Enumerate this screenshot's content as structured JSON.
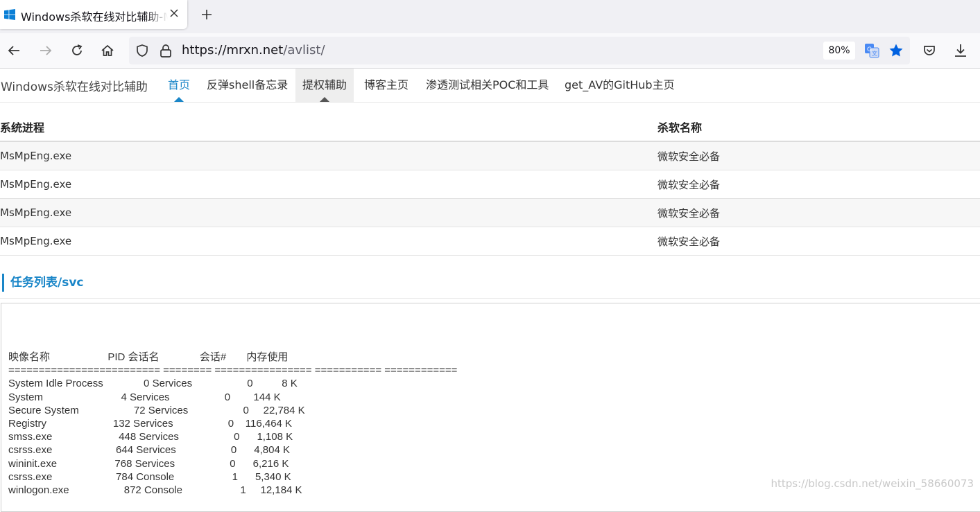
{
  "browser": {
    "tab_title": "Windows杀软在线对比辅助-Mrxn",
    "url_host": "https://mrxn.net",
    "url_path": "/avlist/",
    "zoom": "80%"
  },
  "site": {
    "brand": "Windows杀软在线对比辅助",
    "nav": [
      "首页",
      "反弹shell备忘录",
      "提权辅助",
      "博客主页",
      "渗透测试相关POC和工具",
      "get_AV的GitHub主页"
    ]
  },
  "table": {
    "headers": [
      "系统进程",
      "杀软名称"
    ],
    "rows": [
      [
        "MsMpEng.exe",
        "微软安全必备"
      ],
      [
        "MsMpEng.exe",
        "微软安全必备"
      ],
      [
        "MsMpEng.exe",
        "微软安全必备"
      ],
      [
        "MsMpEng.exe",
        "微软安全必备"
      ]
    ]
  },
  "section": {
    "title": "任务列表/svc"
  },
  "tasklist": "映像名称                    PID 会话名              会话#       内存使用\n========================= ======== ================ =========== ============\nSystem Idle Process              0 Services                   0          8 K\nSystem                           4 Services                   0        144 K\nSecure System                   72 Services                   0     22,784 K\nRegistry                       132 Services                   0    116,464 K\nsmss.exe                       448 Services                   0      1,108 K\ncsrss.exe                      644 Services                   0      4,804 K\nwininit.exe                    768 Services                   0      6,216 K\ncsrss.exe                      784 Console                    1      5,340 K\nwinlogon.exe                   872 Console                    1     12,184 K",
  "watermark": "https://blog.csdn.net/weixin_58660073"
}
